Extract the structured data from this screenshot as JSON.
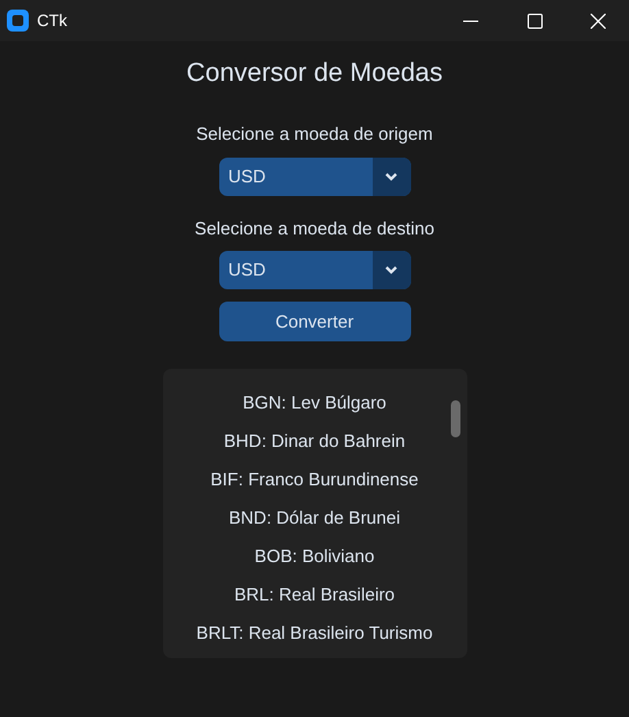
{
  "window": {
    "title": "CTk"
  },
  "heading": "Conversor de Moedas",
  "source": {
    "label": "Selecione a moeda de origem",
    "value": "USD"
  },
  "target": {
    "label": "Selecione a moeda de destino",
    "value": "USD"
  },
  "convert_button": "Converter",
  "currency_list": [
    "BGN: Lev Búlgaro",
    "BHD: Dinar do Bahrein",
    "BIF: Franco Burundinense",
    "BND: Dólar de Brunei",
    "BOB: Boliviano",
    "BRL: Real Brasileiro",
    "BRLT: Real Brasileiro Turismo"
  ]
}
